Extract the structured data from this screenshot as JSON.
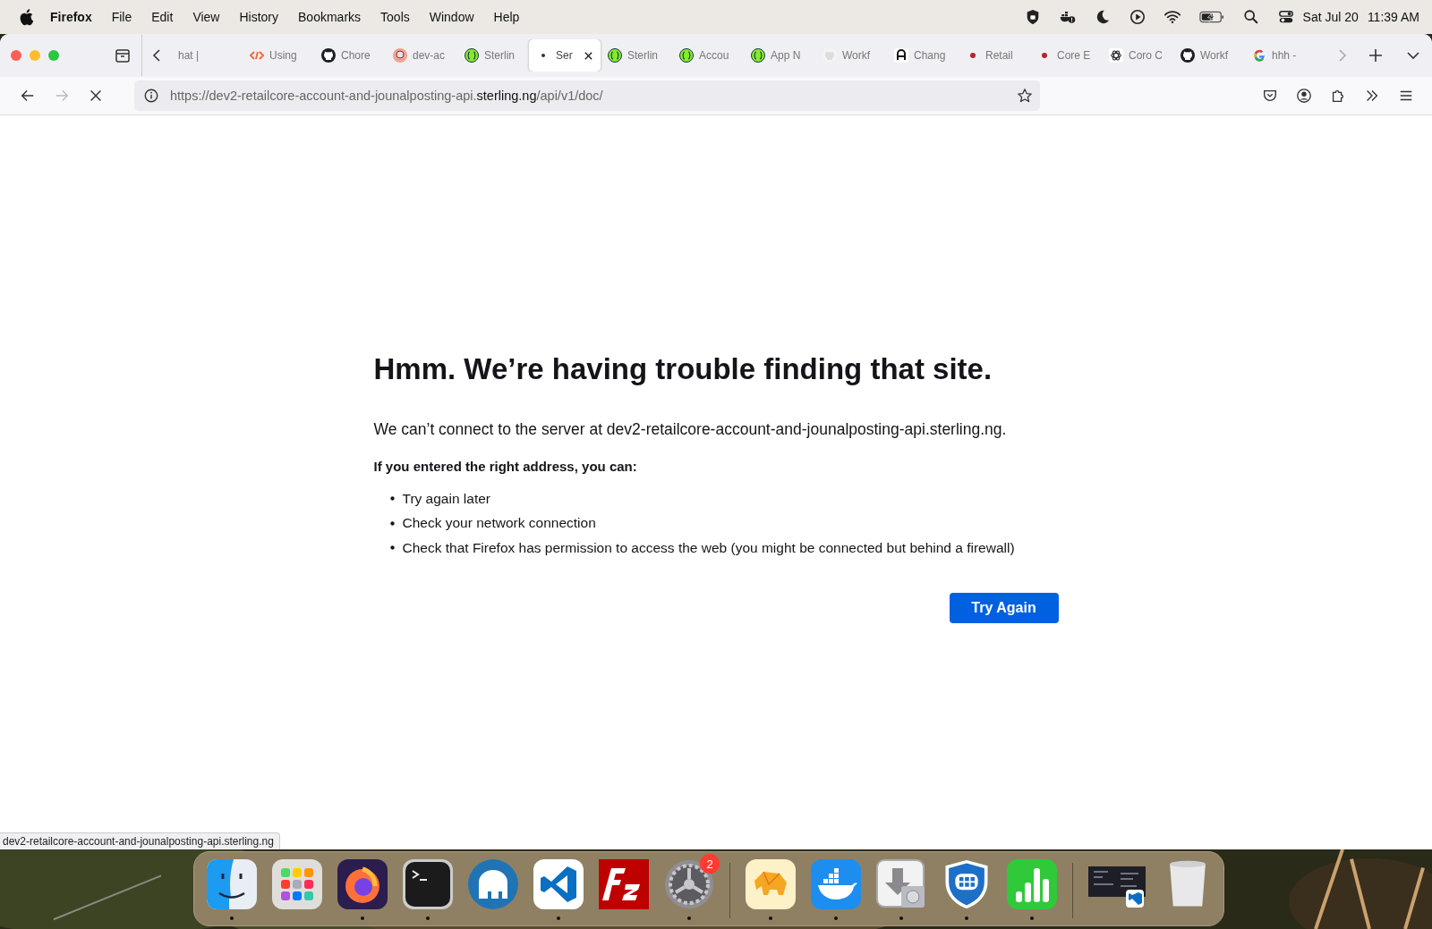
{
  "menu_bar": {
    "app": "Firefox",
    "items": [
      "File",
      "Edit",
      "View",
      "History",
      "Bookmarks",
      "Tools",
      "Window",
      "Help"
    ],
    "date": "Sat Jul 20",
    "time": "11:39 AM"
  },
  "tabs": [
    {
      "label": "hat |",
      "kind": "none",
      "selected": false
    },
    {
      "label": "Using",
      "kind": "postman",
      "selected": false
    },
    {
      "label": "Chore",
      "kind": "github",
      "selected": false
    },
    {
      "label": "dev-ac",
      "kind": "avatar",
      "selected": false
    },
    {
      "label": "Sterlin",
      "kind": "api",
      "selected": false
    },
    {
      "label": "Ser",
      "kind": "dot",
      "selected": true
    },
    {
      "label": "Sterlin",
      "kind": "api",
      "selected": false
    },
    {
      "label": "Accou",
      "kind": "api",
      "selected": false
    },
    {
      "label": "App N",
      "kind": "api",
      "selected": false
    },
    {
      "label": "Workf",
      "kind": "github-light",
      "selected": false
    },
    {
      "label": "Chang",
      "kind": "letter-a",
      "selected": false
    },
    {
      "label": "Retail",
      "kind": "red-dot",
      "selected": false
    },
    {
      "label": "Core E",
      "kind": "red-dot",
      "selected": false
    },
    {
      "label": "Coro C",
      "kind": "openai",
      "selected": false
    },
    {
      "label": "Workf",
      "kind": "github",
      "selected": false
    },
    {
      "label": "hhh -",
      "kind": "google",
      "selected": false
    }
  ],
  "address_bar": {
    "url_start": "https://dev2-retailcore-account-and-jounalposting-api.",
    "url_domain": "sterling.ng",
    "url_end": "/api/v1/doc/"
  },
  "error_page": {
    "title": "Hmm. We’re having trouble finding that site.",
    "message": "We can’t connect to the server at dev2-retailcore-account-and-jounalposting-api.sterling.ng.",
    "subheading": "If you entered the right address, you can:",
    "suggestions": [
      "Try again later",
      "Check your network connection",
      "Check that Firefox has permission to access the web (you might be connected but behind a firewall)"
    ],
    "button": "Try Again"
  },
  "status_text": "dev2-retailcore-account-and-jounalposting-api.sterling.ng",
  "dock": {
    "apps": [
      {
        "kind": "finder",
        "running": true
      },
      {
        "kind": "launchpad",
        "running": false
      },
      {
        "kind": "firefox",
        "running": true
      },
      {
        "kind": "terminal",
        "running": true
      },
      {
        "kind": "mamp",
        "running": false
      },
      {
        "kind": "vscode",
        "running": true
      },
      {
        "kind": "filezilla",
        "running": false
      },
      {
        "kind": "settings",
        "running": true,
        "badge": "2"
      }
    ],
    "apps_recent": [
      {
        "kind": "tableplus",
        "running": true
      },
      {
        "kind": "docker",
        "running": true
      },
      {
        "kind": "installer",
        "running": true
      },
      {
        "kind": "forticlient",
        "running": true
      },
      {
        "kind": "numbers",
        "running": true
      }
    ],
    "others": [
      {
        "kind": "window-preview"
      },
      {
        "kind": "trash"
      }
    ]
  }
}
